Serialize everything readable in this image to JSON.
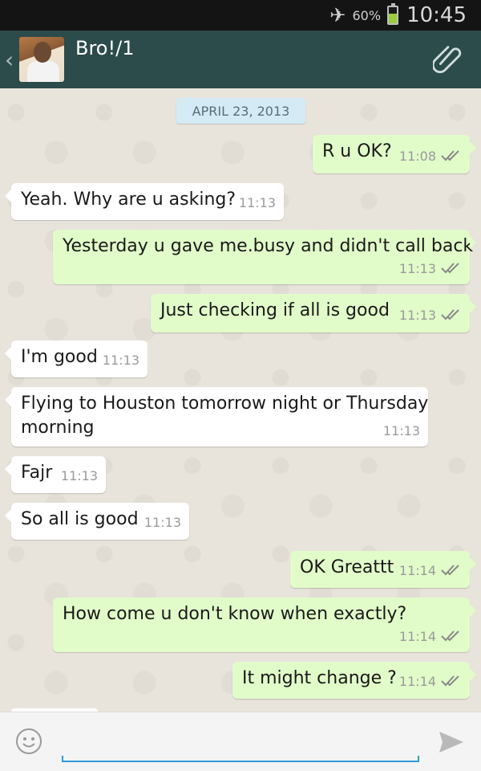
{
  "status_bar": {
    "battery_percent_label": "60%",
    "battery_level": 0.6,
    "time": "10:45",
    "icons": [
      "airplane-mode-icon",
      "battery-icon"
    ]
  },
  "header": {
    "contact_name": "Bro!/1",
    "icons": [
      "back-chevron-icon",
      "avatar",
      "paperclip-attach-icon"
    ],
    "back_glyph": "‹"
  },
  "chat": {
    "date_separator": "APRIL 23, 2013",
    "messages": [
      {
        "direction": "out",
        "text": "R u OK?",
        "time": "11:08",
        "status": "delivered"
      },
      {
        "direction": "in",
        "text": "Yeah. Why are u asking?",
        "time": "11:13"
      },
      {
        "direction": "out",
        "text": "Yesterday u gave me.busy and didn't call back",
        "time": "11:13",
        "status": "delivered"
      },
      {
        "direction": "out",
        "text": "Just checking if all is good",
        "time": "11:13",
        "status": "delivered"
      },
      {
        "direction": "in",
        "text": "I'm good",
        "time": "11:13"
      },
      {
        "direction": "in",
        "text": "Flying to Houston tomorrow night or Thursday",
        "text_line2": "morning",
        "time": "11:13"
      },
      {
        "direction": "in",
        "text": "Fajr",
        "time": "11:13"
      },
      {
        "direction": "in",
        "text": "So all is good",
        "time": "11:13"
      },
      {
        "direction": "out",
        "text": "OK Greattt",
        "time": "11:14",
        "status": "delivered"
      },
      {
        "direction": "out",
        "text": "How come u don't know when exactly?",
        "time": "11:14",
        "status": "delivered"
      },
      {
        "direction": "out",
        "text": "It might change ?",
        "time": "11:14",
        "status": "delivered"
      }
    ]
  },
  "composer": {
    "message_value": "",
    "icons": [
      "emoji-icon",
      "send-icon"
    ]
  },
  "colors": {
    "action_bar": "#2c4b4b",
    "outgoing_bubble": "#e1fbc9",
    "incoming_bubble": "#ffffff",
    "date_pill": "#d4eaf4",
    "input_accent": "#2f9ad6",
    "battery_fill": "#9ccc3b"
  }
}
